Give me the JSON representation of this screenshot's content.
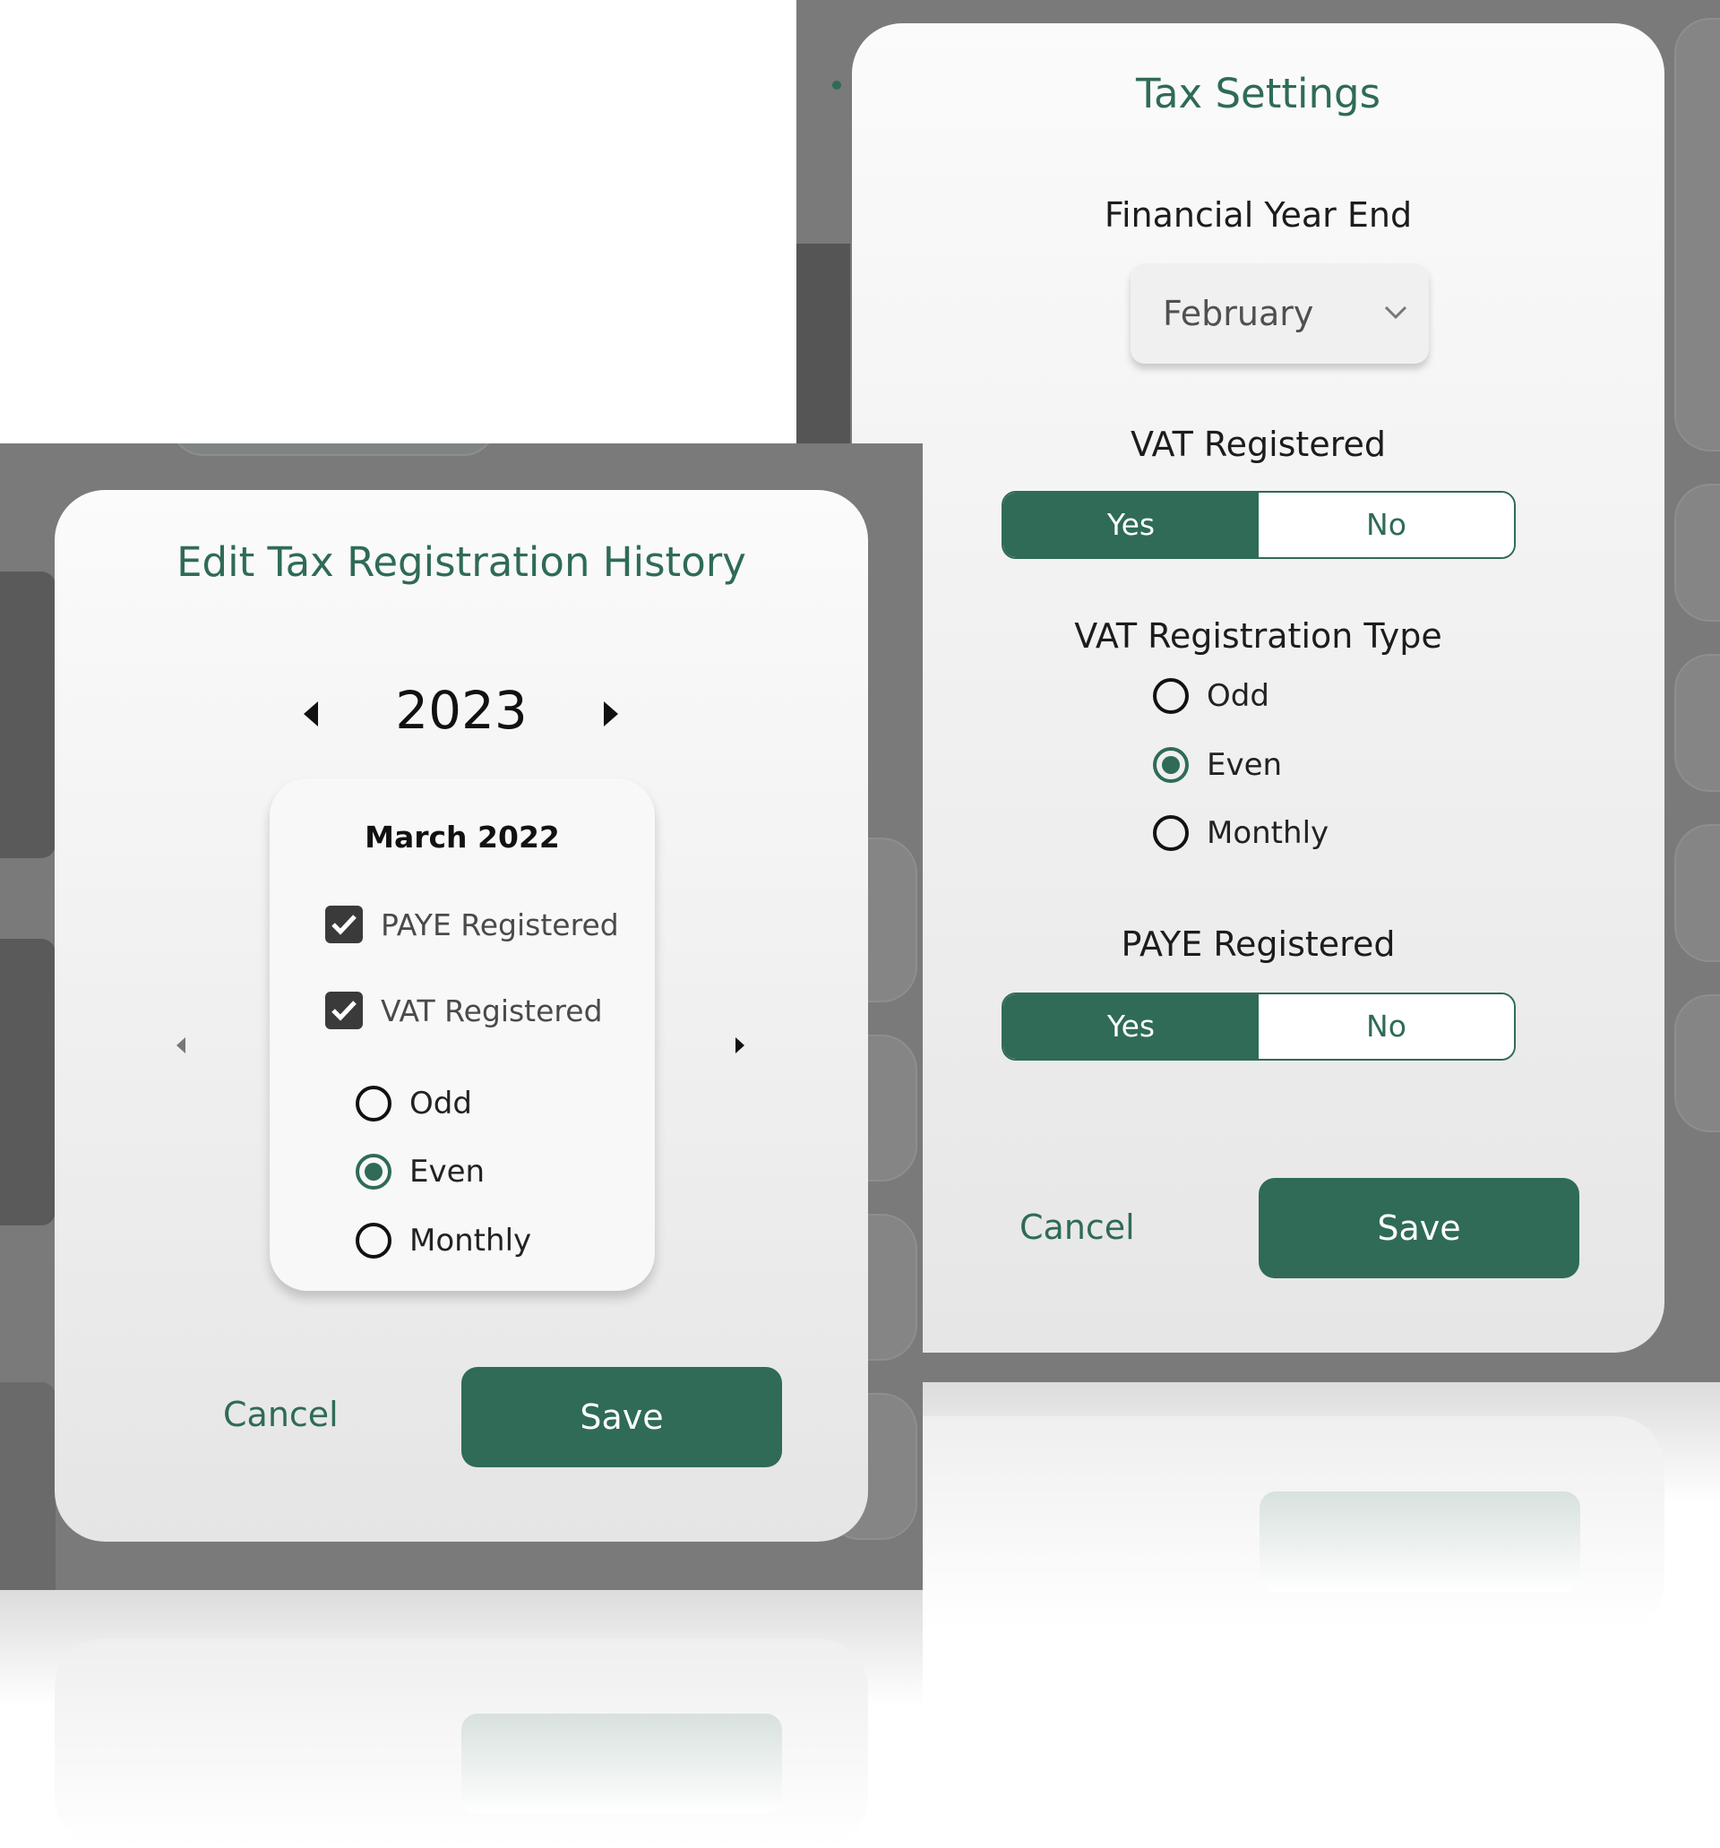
{
  "tax_settings": {
    "title": "Tax Settings",
    "financial_year_end_label": "Financial Year End",
    "financial_year_end_value": "February",
    "vat_registered_label": "VAT Registered",
    "vat_registered_yes": "Yes",
    "vat_registered_no": "No",
    "vat_registered_selected": "Yes",
    "vat_type_label": "VAT Registration Type",
    "vat_type_options": [
      "Odd",
      "Even",
      "Monthly"
    ],
    "vat_type_selected": "Even",
    "paye_registered_label": "PAYE Registered",
    "paye_registered_yes": "Yes",
    "paye_registered_no": "No",
    "paye_registered_selected": "Yes",
    "cancel_label": "Cancel",
    "save_label": "Save"
  },
  "history": {
    "title": "Edit Tax Registration History",
    "year": "2023",
    "month_title": "March 2022",
    "paye_registered_label": "PAYE Registered",
    "paye_registered_checked": true,
    "vat_registered_label": "VAT Registered",
    "vat_registered_checked": true,
    "vat_type_options": [
      "Odd",
      "Even",
      "Monthly"
    ],
    "vat_type_selected": "Even",
    "cancel_label": "Cancel",
    "save_label": "Save"
  },
  "colors": {
    "accent": "#2f6b57",
    "overlay": "#7a7a7a"
  },
  "icons": [
    "chevron-down-icon",
    "caret-left-icon",
    "caret-right-icon",
    "checkmark-icon"
  ]
}
